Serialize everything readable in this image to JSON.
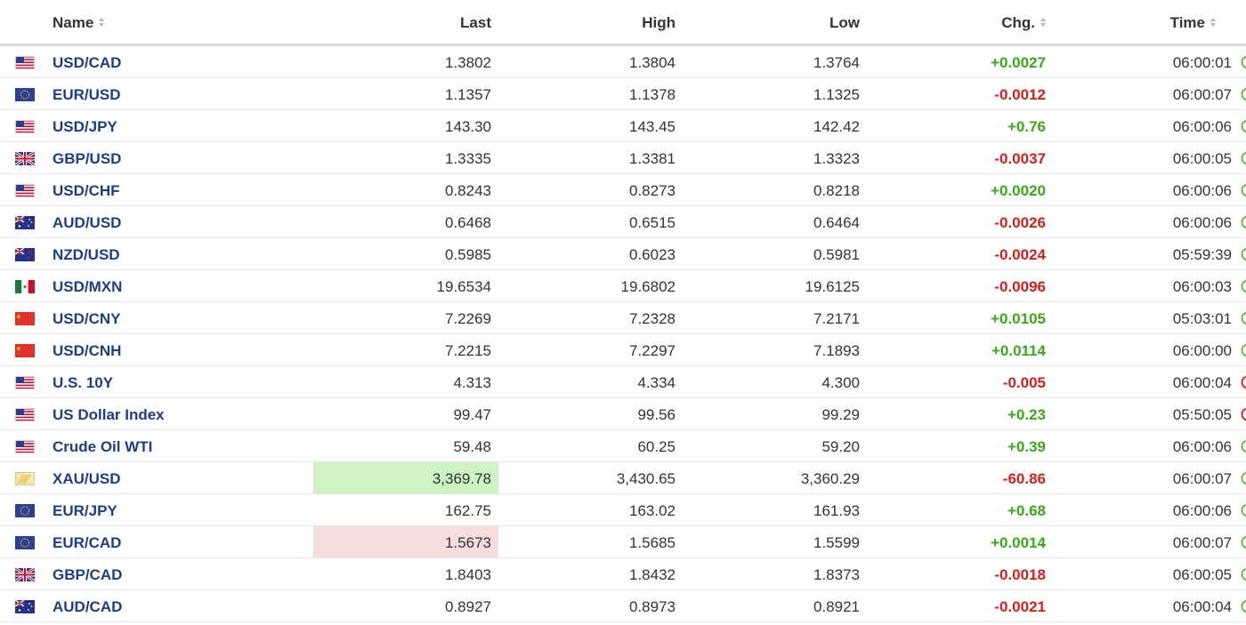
{
  "table": {
    "headers": {
      "name": "Name",
      "last": "Last",
      "high": "High",
      "low": "Low",
      "chg": "Chg.",
      "time": "Time"
    },
    "colors": {
      "up": "#3aa818",
      "down": "#d0201a",
      "link": "#1f3c88",
      "flash_up": "#cdf2c4",
      "flash_down": "#f6dede"
    },
    "rows": [
      {
        "flag": "us-flag",
        "name": "USD/CAD",
        "last": "1.3802",
        "high": "1.3804",
        "low": "1.3764",
        "chg": "+0.0027",
        "dir": "up",
        "time": "06:00:01",
        "status": "open",
        "flash": ""
      },
      {
        "flag": "eu-flag",
        "name": "EUR/USD",
        "last": "1.1357",
        "high": "1.1378",
        "low": "1.1325",
        "chg": "-0.0012",
        "dir": "down",
        "time": "06:00:07",
        "status": "open",
        "flash": ""
      },
      {
        "flag": "us-flag",
        "name": "USD/JPY",
        "last": "143.30",
        "high": "143.45",
        "low": "142.42",
        "chg": "+0.76",
        "dir": "up",
        "time": "06:00:06",
        "status": "open",
        "flash": ""
      },
      {
        "flag": "uk-flag",
        "name": "GBP/USD",
        "last": "1.3335",
        "high": "1.3381",
        "low": "1.3323",
        "chg": "-0.0037",
        "dir": "down",
        "time": "06:00:05",
        "status": "open",
        "flash": ""
      },
      {
        "flag": "us-flag",
        "name": "USD/CHF",
        "last": "0.8243",
        "high": "0.8273",
        "low": "0.8218",
        "chg": "+0.0020",
        "dir": "up",
        "time": "06:00:06",
        "status": "open",
        "flash": ""
      },
      {
        "flag": "au-flag",
        "name": "AUD/USD",
        "last": "0.6468",
        "high": "0.6515",
        "low": "0.6464",
        "chg": "-0.0026",
        "dir": "down",
        "time": "06:00:06",
        "status": "open",
        "flash": ""
      },
      {
        "flag": "nz-flag",
        "name": "NZD/USD",
        "last": "0.5985",
        "high": "0.6023",
        "low": "0.5981",
        "chg": "-0.0024",
        "dir": "down",
        "time": "05:59:39",
        "status": "open",
        "flash": ""
      },
      {
        "flag": "mx-flag",
        "name": "USD/MXN",
        "last": "19.6534",
        "high": "19.6802",
        "low": "19.6125",
        "chg": "-0.0096",
        "dir": "down",
        "time": "06:00:03",
        "status": "open",
        "flash": ""
      },
      {
        "flag": "cn-flag",
        "name": "USD/CNY",
        "last": "7.2269",
        "high": "7.2328",
        "low": "7.2171",
        "chg": "+0.0105",
        "dir": "up",
        "time": "05:03:01",
        "status": "open",
        "flash": ""
      },
      {
        "flag": "cn-flag",
        "name": "USD/CNH",
        "last": "7.2215",
        "high": "7.2297",
        "low": "7.1893",
        "chg": "+0.0114",
        "dir": "up",
        "time": "06:00:00",
        "status": "open",
        "flash": ""
      },
      {
        "flag": "us-flag",
        "name": "U.S. 10Y",
        "last": "4.313",
        "high": "4.334",
        "low": "4.300",
        "chg": "-0.005",
        "dir": "down",
        "time": "06:00:04",
        "status": "closed",
        "flash": ""
      },
      {
        "flag": "us-flag",
        "name": "US Dollar Index",
        "last": "99.47",
        "high": "99.56",
        "low": "99.29",
        "chg": "+0.23",
        "dir": "up",
        "time": "05:50:05",
        "status": "closed",
        "flash": ""
      },
      {
        "flag": "us-flag",
        "name": "Crude Oil WTI",
        "last": "59.48",
        "high": "60.25",
        "low": "59.20",
        "chg": "+0.39",
        "dir": "up",
        "time": "06:00:06",
        "status": "open",
        "flash": ""
      },
      {
        "flag": "gold-icon",
        "name": "XAU/USD",
        "last": "3,369.78",
        "high": "3,430.65",
        "low": "3,360.29",
        "chg": "-60.86",
        "dir": "down",
        "time": "06:00:07",
        "status": "open",
        "flash": "up"
      },
      {
        "flag": "eu-flag",
        "name": "EUR/JPY",
        "last": "162.75",
        "high": "163.02",
        "low": "161.93",
        "chg": "+0.68",
        "dir": "up",
        "time": "06:00:06",
        "status": "open",
        "flash": ""
      },
      {
        "flag": "eu-flag",
        "name": "EUR/CAD",
        "last": "1.5673",
        "high": "1.5685",
        "low": "1.5599",
        "chg": "+0.0014",
        "dir": "up",
        "time": "06:00:07",
        "status": "open",
        "flash": "down"
      },
      {
        "flag": "uk-flag",
        "name": "GBP/CAD",
        "last": "1.8403",
        "high": "1.8432",
        "low": "1.8373",
        "chg": "-0.0018",
        "dir": "down",
        "time": "06:00:05",
        "status": "open",
        "flash": ""
      },
      {
        "flag": "au-flag",
        "name": "AUD/CAD",
        "last": "0.8927",
        "high": "0.8973",
        "low": "0.8921",
        "chg": "-0.0021",
        "dir": "down",
        "time": "06:00:04",
        "status": "open",
        "flash": ""
      }
    ]
  }
}
